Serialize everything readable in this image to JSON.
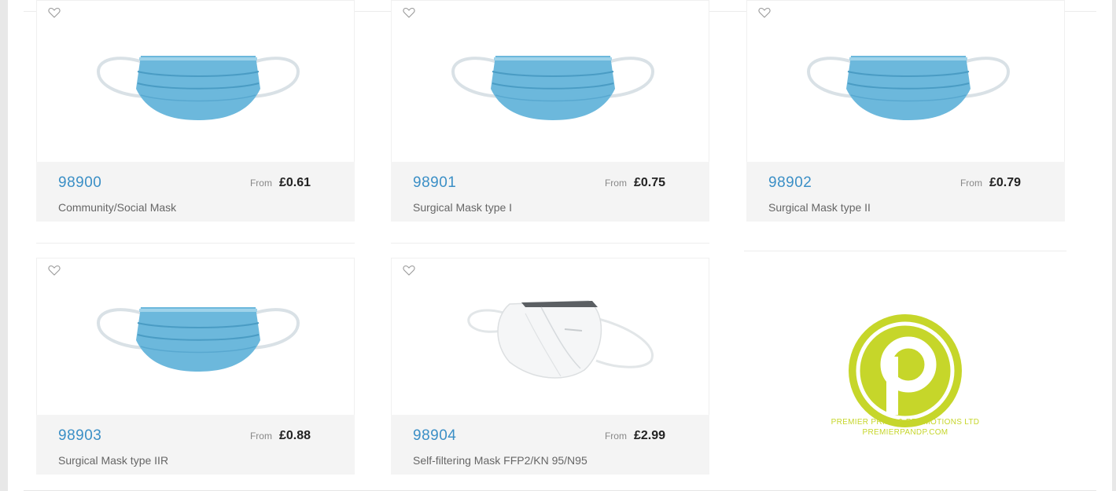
{
  "products": [
    {
      "code": "98900",
      "from_label": "From",
      "price": "£0.61",
      "name": "Community/Social Mask",
      "image": "surgical-mask-image"
    },
    {
      "code": "98901",
      "from_label": "From",
      "price": "£0.75",
      "name": "Surgical Mask type I",
      "image": "surgical-mask-image"
    },
    {
      "code": "98902",
      "from_label": "From",
      "price": "£0.79",
      "name": "Surgical Mask type II",
      "image": "surgical-mask-image"
    },
    {
      "code": "98903",
      "from_label": "From",
      "price": "£0.88",
      "name": "Surgical Mask type IIR",
      "image": "surgical-mask-image"
    },
    {
      "code": "98904",
      "from_label": "From",
      "price": "£2.99",
      "name": "Self-filtering Mask FFP2/KN 95/N95",
      "image": "ffp2-mask-image"
    }
  ],
  "logo": {
    "letter": "P",
    "company": "PREMIER PRINT & PROMOTIONS LTD",
    "website": "PREMIERPANDP.COM",
    "color": "#c6d62a"
  },
  "colors": {
    "code": "#3b8fc6",
    "info_background": "#f4f4f4",
    "mask_blue": "#6cb8dc"
  },
  "icons": {
    "favourite": "heart-outline-icon"
  }
}
